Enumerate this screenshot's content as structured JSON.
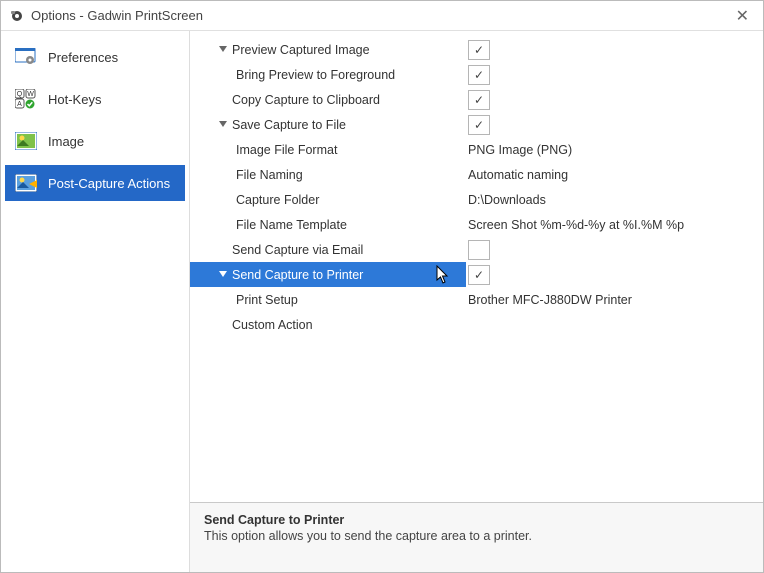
{
  "window": {
    "title": "Options - Gadwin PrintScreen",
    "close_glyph": "✕"
  },
  "sidebar": {
    "items": [
      {
        "label": "Preferences"
      },
      {
        "label": "Hot-Keys"
      },
      {
        "label": "Image"
      },
      {
        "label": "Post-Capture Actions"
      }
    ]
  },
  "options": {
    "preview_captured_image": {
      "label": "Preview Captured Image",
      "checked": true
    },
    "bring_preview_foreground": {
      "label": "Bring Preview to Foreground",
      "checked": true
    },
    "copy_clipboard": {
      "label": "Copy Capture to Clipboard",
      "checked": true
    },
    "save_to_file": {
      "label": "Save Capture to File",
      "checked": true
    },
    "image_file_format": {
      "label": "Image File Format",
      "value": "PNG Image (PNG)"
    },
    "file_naming": {
      "label": "File Naming",
      "value": "Automatic naming"
    },
    "capture_folder": {
      "label": "Capture Folder",
      "value": "D:\\Downloads"
    },
    "file_name_template": {
      "label": "File Name Template",
      "value": "Screen Shot %m-%d-%y at %I.%M %p"
    },
    "send_email": {
      "label": "Send Capture via Email",
      "checked": false
    },
    "send_printer": {
      "label": "Send Capture to Printer",
      "checked": true
    },
    "print_setup": {
      "label": "Print Setup",
      "value": "Brother MFC-J880DW Printer"
    },
    "custom_action": {
      "label": "Custom Action"
    }
  },
  "description": {
    "title": "Send Capture to Printer",
    "text": "This option allows you to send the capture area to a printer."
  }
}
